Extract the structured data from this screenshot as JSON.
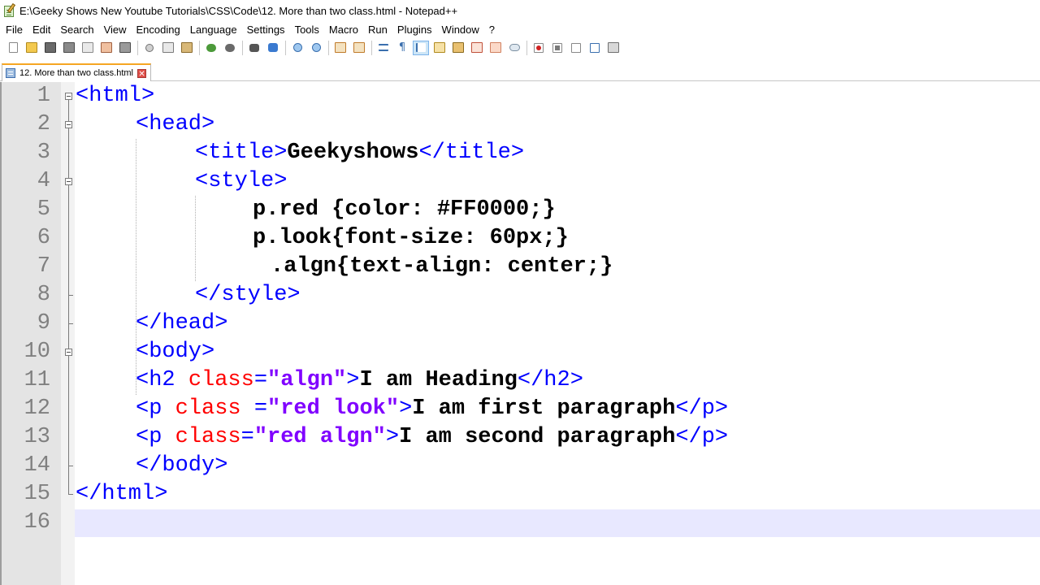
{
  "window": {
    "title": "E:\\Geeky Shows New Youtube Tutorials\\CSS\\Code\\12. More than two class.html - Notepad++"
  },
  "menu": [
    "File",
    "Edit",
    "Search",
    "View",
    "Encoding",
    "Language",
    "Settings",
    "Tools",
    "Macro",
    "Run",
    "Plugins",
    "Window",
    "?"
  ],
  "toolbar": {
    "icons": [
      "new-file-icon",
      "open-file-icon",
      "save-icon",
      "save-all-icon",
      "close-icon",
      "close-all-icon",
      "print-icon",
      "cut-icon",
      "copy-icon",
      "paste-icon",
      "undo-icon",
      "redo-icon",
      "find-icon",
      "replace-icon",
      "zoom-in-icon",
      "zoom-out-icon",
      "sync-vertical-icon",
      "sync-horizontal-icon",
      "word-wrap-icon",
      "show-all-chars-icon",
      "indent-guide-icon",
      "user-defined-lang-icon",
      "doc-map-icon",
      "function-list-icon",
      "folder-workspace-icon",
      "monitoring-icon",
      "record-macro-icon",
      "stop-record-icon",
      "playback-icon",
      "run-macro-multiple-icon",
      "save-macro-icon"
    ]
  },
  "tab": {
    "label": "12. More than two class.html"
  },
  "editor": {
    "line_numbers": [
      "1",
      "2",
      "3",
      "4",
      "5",
      "6",
      "7",
      "8",
      "9",
      "10",
      "11",
      "12",
      "13",
      "14",
      "15",
      "16"
    ],
    "lines": {
      "l1": {
        "a": "<html>"
      },
      "l2": {
        "a": "<head>"
      },
      "l3": {
        "a": "<title>",
        "b": "Geekyshows",
        "c": "</title>"
      },
      "l4": {
        "a": "<style>"
      },
      "l5": {
        "a": "p.red {color: #FF0000;}"
      },
      "l6": {
        "a": "p.look{font-size: 60px;}"
      },
      "l7": {
        "a": ".algn{text-align: center;}"
      },
      "l8": {
        "a": "</style>"
      },
      "l9": {
        "a": "</head>"
      },
      "l10": {
        "a": "<body>"
      },
      "l11": {
        "a": "<h2 ",
        "b": "class",
        "c": "=",
        "d": "\"algn\"",
        "e": ">",
        "f": "I am Heading",
        "g": "</h2>"
      },
      "l12": {
        "a": "<p ",
        "b": "class ",
        "c": "=",
        "d": "\"red look\"",
        "e": ">",
        "f": "I am first paragraph",
        "g": "</p>"
      },
      "l13": {
        "a": "<p ",
        "b": "class",
        "c": "=",
        "d": "\"red algn\"",
        "e": ">",
        "f": "I am second paragraph",
        "g": "</p>"
      },
      "l14": {
        "a": "</body>"
      },
      "l15": {
        "a": "</html>"
      }
    }
  },
  "colors": {
    "tag": "#0000ff",
    "attribute": "#ff0000",
    "string": "#8000ff",
    "current_line": "#e8e8ff",
    "tab_accent": "#f5a623"
  }
}
